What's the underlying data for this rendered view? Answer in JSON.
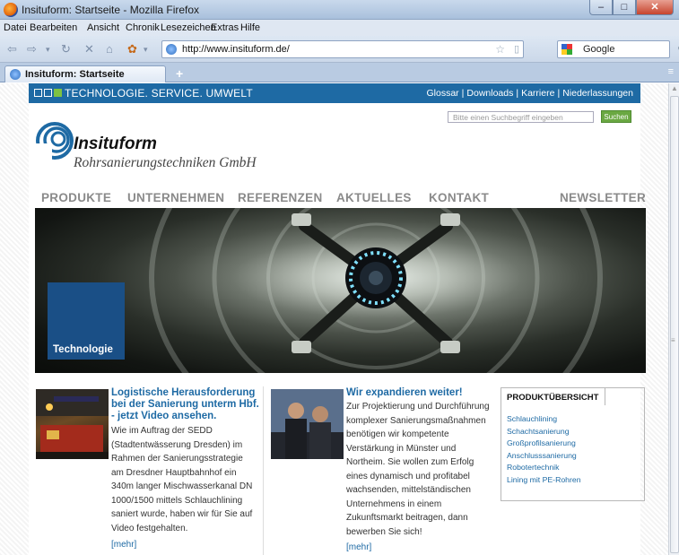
{
  "window": {
    "title": "Insituform: Startseite - Mozilla Firefox",
    "min": "–",
    "max": "□",
    "close": "✕"
  },
  "menu": [
    "Datei",
    "Bearbeiten",
    "Ansicht",
    "Chronik",
    "Lesezeichen",
    "Extras",
    "Hilfe"
  ],
  "navbar": {
    "url": "http://www.insituform.de/",
    "search_engine": "Google"
  },
  "tab": {
    "label": "Insituform: Startseite",
    "new": "+"
  },
  "site": {
    "tagline": "TECHNOLOGIE. SERVICE. UMWELT",
    "toplinks": [
      "Glossar",
      "Downloads",
      "Karriere",
      "Niederlassungen"
    ],
    "search_placeholder": "Bitte einen Suchbegriff eingeben",
    "search_button": "Suchen",
    "logo_name": "Insituform",
    "logo_sub": "Rohrsanierungstechniken GmbH",
    "nav": [
      "PRODUKTE",
      "UNTERNEHMEN",
      "REFERENZEN",
      "AKTUELLES",
      "KONTAKT",
      "NEWSLETTER"
    ],
    "hero_label": "Technologie",
    "news": [
      {
        "title_lines": [
          "Logistische Herausforderung",
          "bei der Sanierung unterm Hbf.",
          "- jetzt Video ansehen."
        ],
        "body_lines": [
          "Wie im Auftrag der SEDD",
          "(Stadtentwässerung Dresden) im",
          "Rahmen der Sanierungsstrategie",
          "am Dresdner Hauptbahnhof ein",
          "340m langer Mischwasserkanal DN",
          "1000/1500 mittels Schlauchlining",
          "saniert wurde, haben wir für Sie auf",
          "Video festgehalten."
        ],
        "more": "[mehr]"
      },
      {
        "title_lines": [
          "Wir expandieren weiter!"
        ],
        "body_lines": [
          "Zur Projektierung und Durchführung",
          "komplexer Sanierungsmaßnahmen",
          "benötigen wir kompetente",
          "Verstärkung in Münster und",
          "Northeim. Sie wollen zum Erfolg",
          "eines dynamisch und profitabel",
          "wachsenden, mittelständischen",
          "Unternehmens in einem",
          "Zukunftsmarkt beitragen, dann",
          "bewerben Sie sich!"
        ],
        "more": "[mehr]"
      }
    ],
    "produkt_title": "PRODUKTÜBERSICHT",
    "produkte": [
      "Schlauchlining",
      "Schachtsanierung",
      "Großprofilsanierung",
      "Anschlusssanierung",
      "Robotertechnik",
      "Lining mit PE-Rohren"
    ]
  }
}
